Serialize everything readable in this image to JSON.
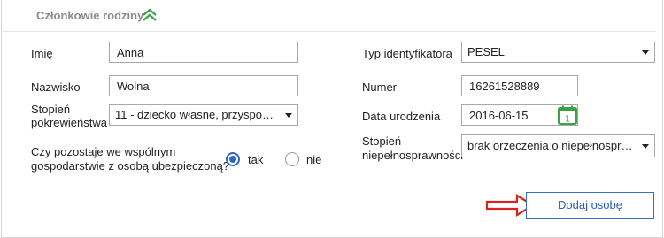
{
  "section": {
    "title": "Członkowie rodziny",
    "collapse_icon": "chevron-double-up-icon"
  },
  "form": {
    "first_name": {
      "label": "Imię",
      "value": "Anna"
    },
    "last_name": {
      "label": "Nazwisko",
      "value": "Wolna"
    },
    "relationship": {
      "label_line1": "Stopień",
      "label_line2": "pokrewieństwa",
      "value": "11 - dziecko własne, przysposobi..."
    },
    "household": {
      "question_line1": "Czy pozostaje we wspólnym",
      "question_line2": "gospodarstwie z osobą ubezpieczoną?",
      "options": [
        {
          "label": "tak",
          "selected": true
        },
        {
          "label": "nie",
          "selected": false
        }
      ]
    },
    "id_type": {
      "label": "Typ identyfikatora",
      "value": "PESEL"
    },
    "number": {
      "label": "Numer",
      "value": "16261528889"
    },
    "birth_date": {
      "label": "Data urodzenia",
      "value": "2016-06-15",
      "calendar_day": "1"
    },
    "disability": {
      "label_line1": "Stopień",
      "label_line2": "niepełnosprawności",
      "value": "brak orzeczenia o niepełnospraw..."
    }
  },
  "actions": {
    "add_person_label": "Dodaj osobę"
  },
  "colors": {
    "accent": "#2e66c7",
    "header_icon": "#3aa14a",
    "arrow": "#d9231c"
  }
}
